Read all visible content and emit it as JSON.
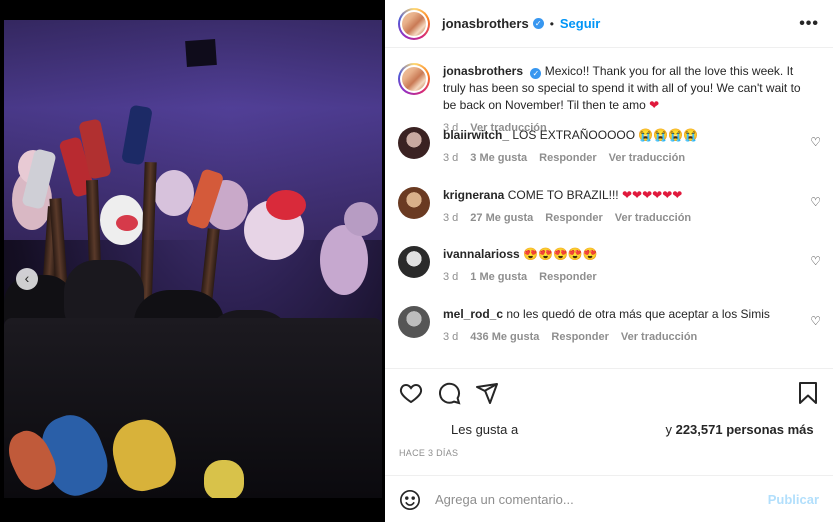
{
  "post": {
    "username": "jonasbrothers",
    "follow_label": "Seguir",
    "dot_separator": "•",
    "more_label": "•••"
  },
  "caption": {
    "username": "jonasbrothers",
    "text": "Mexico!! Thank you for all the love this week. It truly has been so special to spend it with all of you! We can't wait to be back on November! Til then te amo",
    "emoji": "❤",
    "time": "3 d",
    "translate": "Ver traducción"
  },
  "comments": [
    {
      "username": "blaiirwitch_",
      "text": "LOS EXTRAÑOOOOO",
      "emoji": "😭😭😭😭",
      "time": "3 d",
      "likes": "3 Me gusta",
      "reply": "Responder",
      "translate": "Ver traducción",
      "avatar_color": "#5a3a3a"
    },
    {
      "username": "krignerana",
      "text": "COME TO BRAZIL!!!",
      "emoji": "❤❤❤❤❤❤",
      "time": "3 d",
      "likes": "27 Me gusta",
      "reply": "Responder",
      "translate": "Ver traducción",
      "avatar_color": "#8a5a3a"
    },
    {
      "username": "ivannalarioss",
      "text": "",
      "emoji": "😍😍😍😍😍",
      "time": "3 d",
      "likes": "1 Me gusta",
      "reply": "Responder",
      "translate": "",
      "avatar_color": "#3a3a3a"
    },
    {
      "username": "mel_rod_c",
      "text": "no les quedó de otra más que aceptar a los Simis",
      "emoji": "",
      "time": "3 d",
      "likes": "436 Me gusta",
      "reply": "Responder",
      "translate": "Ver traducción",
      "avatar_color": "#6a6a6a"
    }
  ],
  "likes": {
    "prefix": "Les gusta a",
    "suffix": "y",
    "count": "223,571 personas más"
  },
  "time_ago": "HACE 3 DÍAS",
  "add_comment": {
    "placeholder": "Agrega un comentario...",
    "publish": "Publicar"
  },
  "carousel": {
    "prev_label": "‹",
    "slides": 3,
    "current": 3
  },
  "colors": {
    "accent": "#0095f6",
    "verified": "#3897f0",
    "publish_disabled": "#b2dffc",
    "heart": "#e0193c"
  },
  "icons": [
    "more-icon",
    "heart-icon",
    "comment-icon",
    "share-icon",
    "bookmark-icon",
    "emoji-icon",
    "verified-icon",
    "chevron-left-icon"
  ]
}
